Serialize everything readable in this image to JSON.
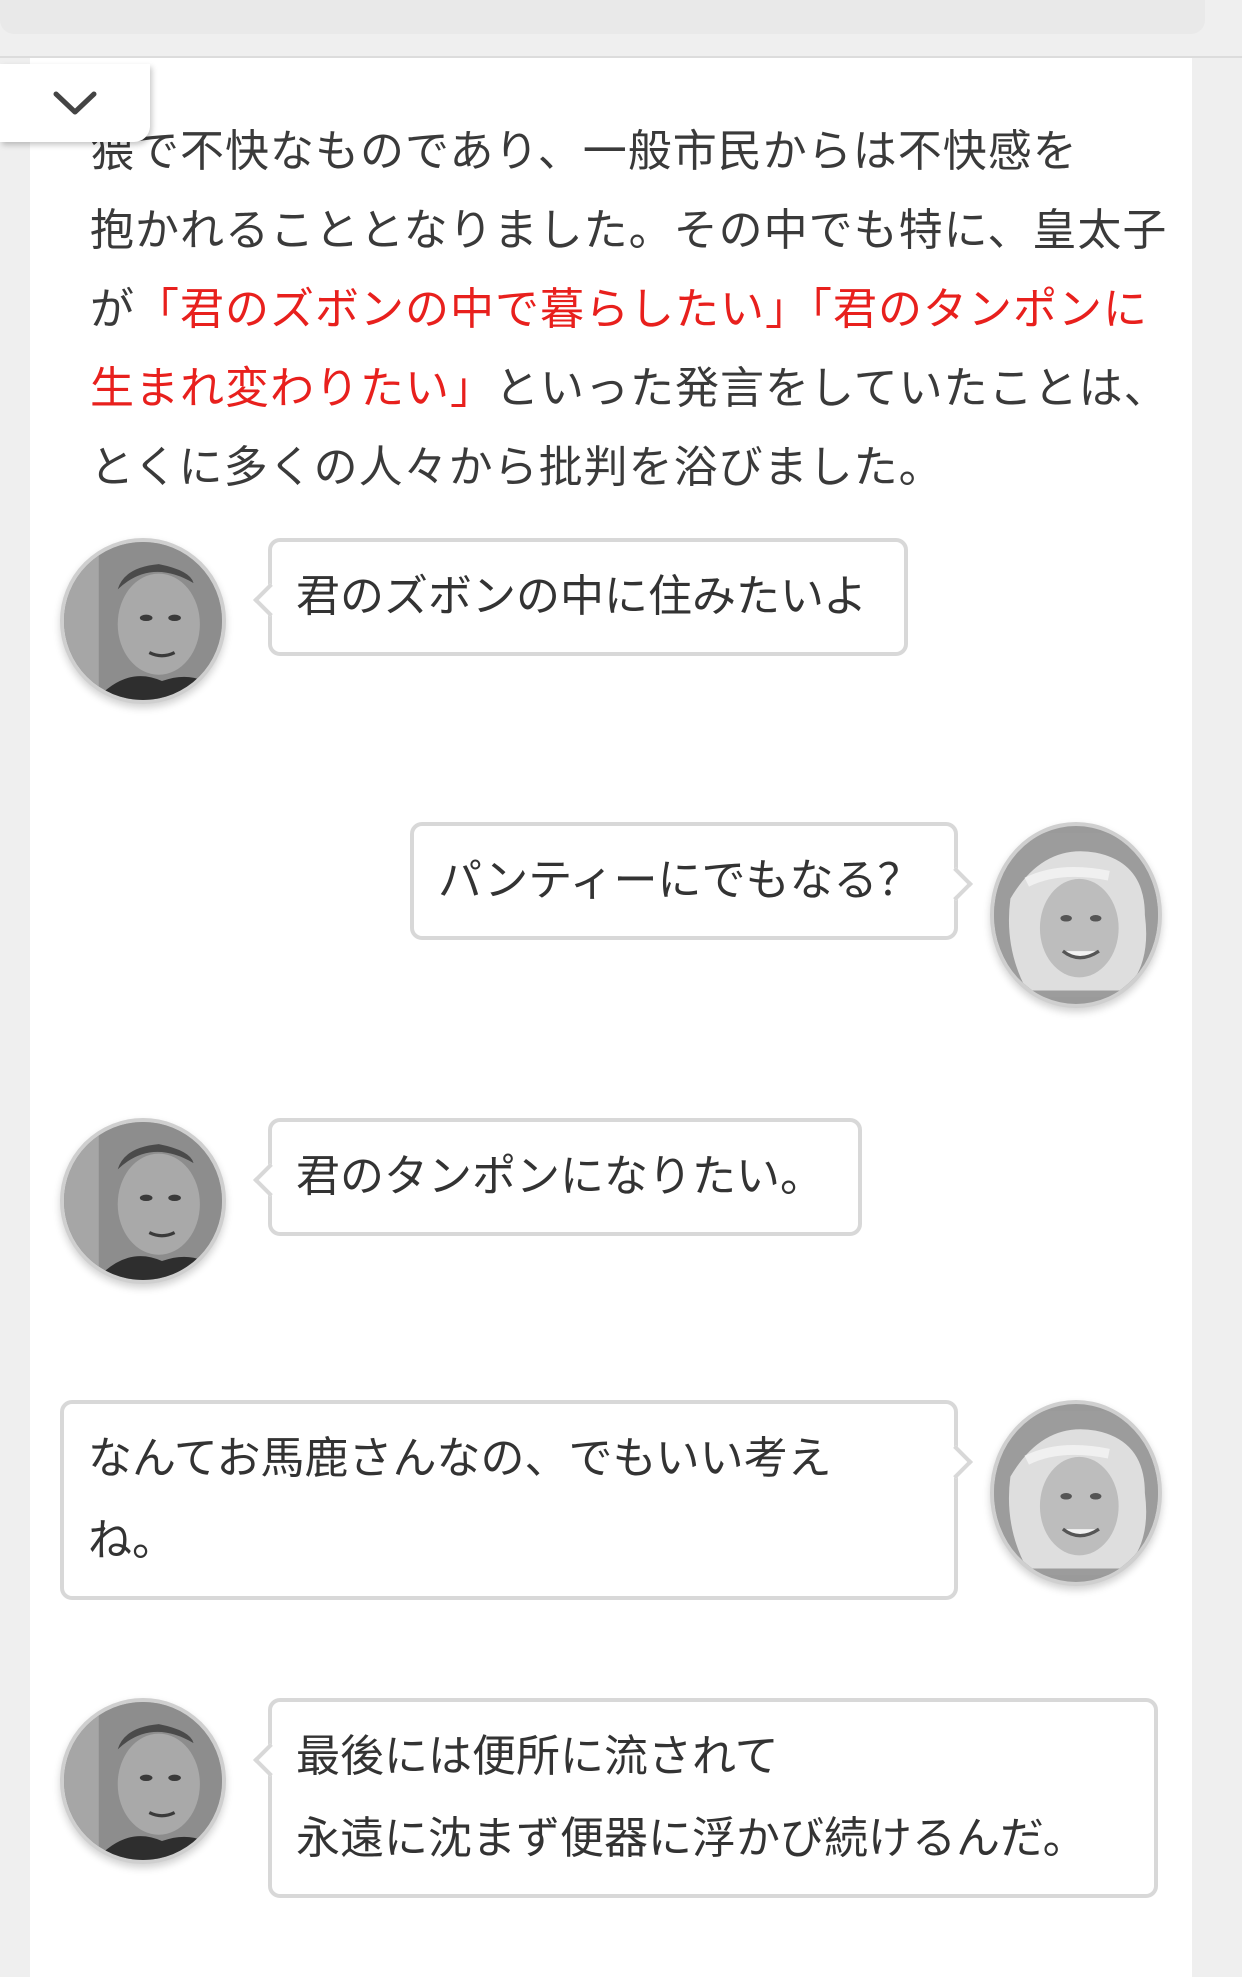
{
  "paragraph": {
    "line1": "猥で不快なものであり、一般市民からは不快感を",
    "line2": "抱かれることとなりました。その中でも特に、皇太子",
    "line3_prefix": "が",
    "line3_quote": "「君のズボンの中で暮らしたい」「君のタンポンに",
    "line4_quote": "生まれ変わりたい」",
    "line4_suffix": "といった発言をしていたことは、",
    "line5": "とくに多くの人々から批判を浴びました。"
  },
  "colors": {
    "highlight": "#e8201d",
    "bubble_border": "#d8d8d8",
    "background": "#efefef"
  },
  "toggle": {
    "icon": "chevron-down-icon"
  },
  "chat": [
    {
      "speaker": "man",
      "side": "left",
      "lines": [
        "君のズボンの中に住みたいよ"
      ]
    },
    {
      "speaker": "woman",
      "side": "right",
      "lines": [
        "パンティーにでもなる？"
      ]
    },
    {
      "speaker": "man",
      "side": "left",
      "lines": [
        "君のタンポンになりたい。"
      ]
    },
    {
      "speaker": "woman",
      "side": "right",
      "lines": [
        "なんてお馬鹿さんなの、でもいい考え",
        "ね。"
      ]
    },
    {
      "speaker": "man",
      "side": "left",
      "lines": [
        "最後には便所に流されて",
        "永遠に沈まず便器に浮かび続けるんだ。"
      ]
    }
  ]
}
